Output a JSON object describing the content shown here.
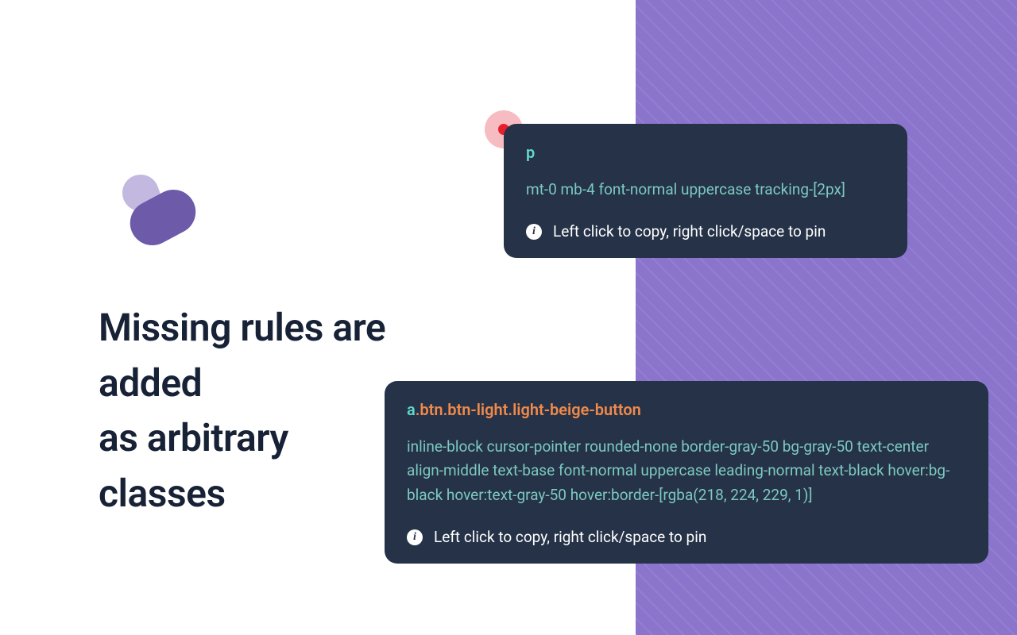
{
  "headline": "Missing rules are\nadded\nas arbitrary\nclasses",
  "tooltip1": {
    "selector_tag": "p",
    "selector_class": "",
    "classes": "mt-0 mb-4 font-normal uppercase tracking-[2px]",
    "hint": "Left click to copy, right click/space to pin"
  },
  "tooltip2": {
    "selector_tag": "a",
    "selector_class": ".btn.btn-light.light-beige-button",
    "classes": "inline-block cursor-pointer rounded-none border-gray-50 bg-gray-50 text-center align-middle text-base font-normal uppercase leading-normal text-black hover:bg-black hover:text-gray-50 hover:border-[rgba(218, 224, 229, 1)]",
    "hint": "Left click to copy, right click/space to pin"
  }
}
